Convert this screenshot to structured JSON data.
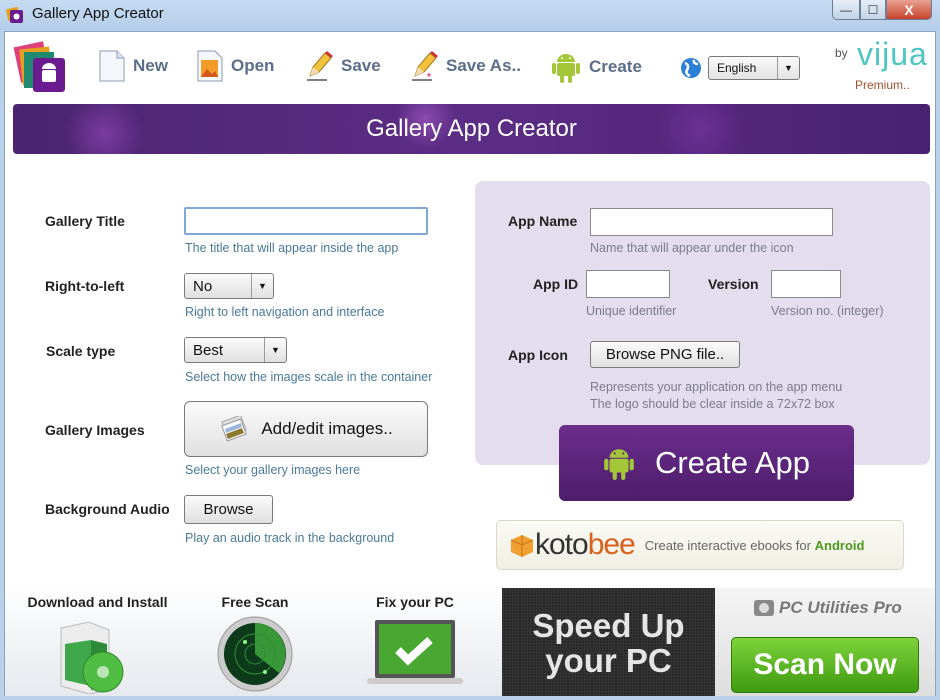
{
  "window": {
    "title": "Gallery App Creator",
    "controls": {
      "minimize": "—",
      "maximize": "☐",
      "close": "X"
    }
  },
  "toolbar": {
    "new_label": "New",
    "open_label": "Open",
    "save_label": "Save",
    "save_as_label": "Save As..",
    "create_label": "Create",
    "language": "English",
    "brand_by": "by",
    "brand_name": "vijua",
    "premium_label": "Premium.."
  },
  "banner": {
    "title": "Gallery App Creator"
  },
  "left_form": {
    "gallery_title": {
      "label": "Gallery Title",
      "value": "",
      "hint": "The title that will appear inside the app"
    },
    "rtl": {
      "label": "Right-to-left",
      "value": "No",
      "hint": "Right to left navigation and interface"
    },
    "scale": {
      "label": "Scale type",
      "value": "Best",
      "hint": "Select how the images scale in the container"
    },
    "images": {
      "label": "Gallery Images",
      "button": "Add/edit images..",
      "hint": "Select your gallery images here"
    },
    "audio": {
      "label": "Background Audio",
      "button": "Browse",
      "hint": "Play an audio track in the background"
    }
  },
  "right_form": {
    "app_name": {
      "label": "App Name",
      "value": "",
      "hint": "Name that will appear under the icon"
    },
    "app_id": {
      "label": "App ID",
      "value": "",
      "hint": "Unique identifier"
    },
    "version": {
      "label": "Version",
      "value": "",
      "hint": "Version no. (integer)"
    },
    "app_icon": {
      "label": "App Icon",
      "button": "Browse PNG file..",
      "hint_line1": "Represents your application on the app menu",
      "hint_line2": "The logo should be clear inside a 72x72 box"
    },
    "create_button": "Create App"
  },
  "kotobee": {
    "brand_a": "koto",
    "brand_b": "bee",
    "tagline": "Create interactive ebooks for",
    "tagline_highlight": "Android"
  },
  "ad": {
    "step1": "Download and Install",
    "step2": "Free Scan",
    "step3": "Fix your PC",
    "headline_line1": "Speed Up",
    "headline_line2": "your PC",
    "product": "PC Utilities Pro",
    "cta": "Scan Now"
  },
  "colors": {
    "accent_purple": "#5c2d85",
    "hint_blue": "#4a7a99",
    "android_green": "#a4c639",
    "scan_green": "#5cb824"
  }
}
